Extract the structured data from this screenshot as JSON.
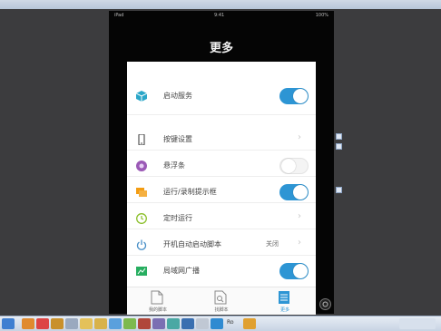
{
  "device": {
    "status_left": "iPad",
    "status_center": "9:41",
    "status_right": "100%"
  },
  "page": {
    "title": "更多"
  },
  "settings": [
    {
      "label": "启动服务",
      "control": "toggle",
      "state": "on",
      "icon": "cube-icon",
      "color": "#2aa6c8"
    },
    {
      "label": "按键设置",
      "control": "chevron",
      "icon": "phone-icon",
      "color": "#555555"
    },
    {
      "label": "悬浮条",
      "control": "toggle",
      "state": "off",
      "icon": "circle-dot-icon",
      "color": "#9b59b6"
    },
    {
      "label": "运行/录制提示框",
      "control": "toggle",
      "state": "on",
      "icon": "window-icon",
      "color": "#f39c12"
    },
    {
      "label": "定时运行",
      "control": "chevron",
      "icon": "clock-icon",
      "color": "#8bbf2a"
    },
    {
      "label": "开机自动启动脚本",
      "control": "value",
      "value": "关闭",
      "icon": "power-icon",
      "color": "#4a90c8"
    },
    {
      "label": "局域网广播",
      "control": "toggle",
      "state": "on",
      "icon": "broadcast-icon",
      "color": "#27ae60"
    }
  ],
  "tabs": [
    {
      "label": "我的脚本",
      "icon": "document-icon",
      "active": false
    },
    {
      "label": "找脚本",
      "icon": "search-document-icon",
      "active": false
    },
    {
      "label": "更多",
      "icon": "list-icon",
      "active": true
    }
  ],
  "taskbar": {
    "item_label": "Ro"
  }
}
